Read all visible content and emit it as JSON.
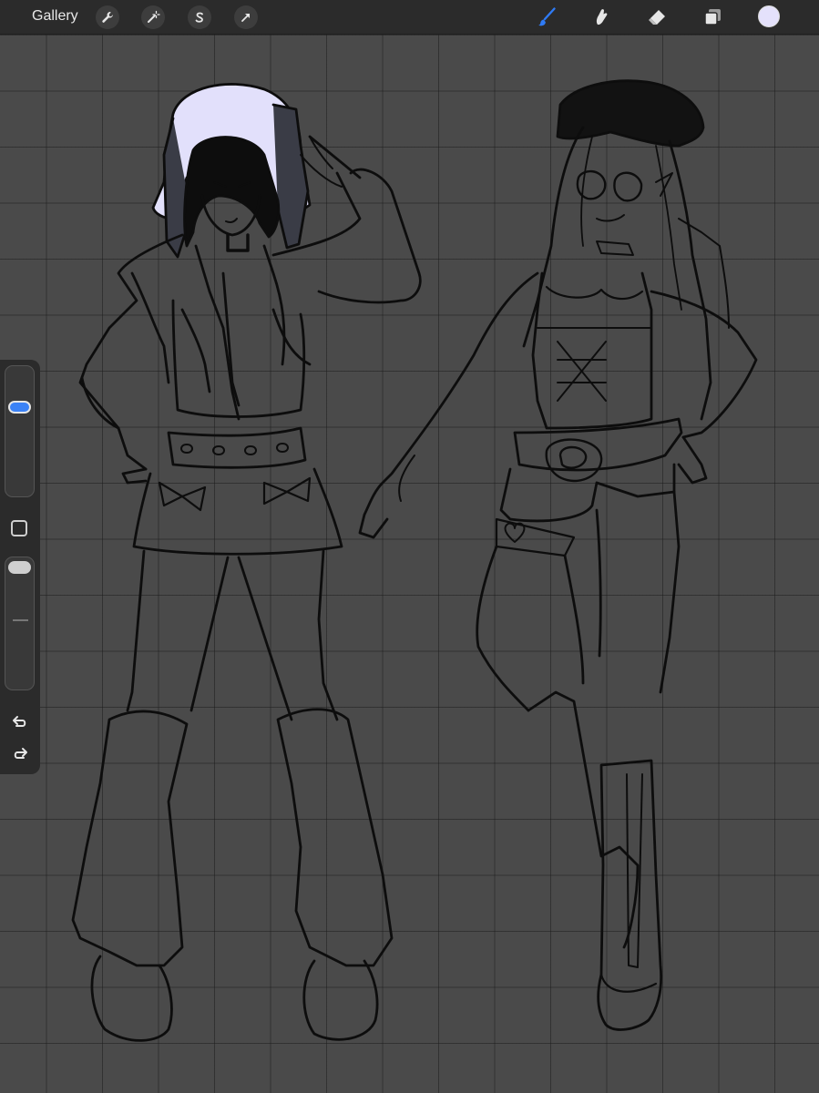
{
  "toolbar": {
    "gallery_label": "Gallery",
    "left_tools": [
      "wrench-icon",
      "magic-wand-icon",
      "selection-s-icon",
      "transform-arrow-icon"
    ],
    "right_tools": [
      "brush-icon",
      "smudge-icon",
      "eraser-icon",
      "layers-icon"
    ],
    "active_tool": "brush",
    "current_color": "#e4e1fb",
    "active_color": "#2f7bf5"
  },
  "sidebar": {
    "brush_size": 0.2,
    "opacity": 0.1
  }
}
